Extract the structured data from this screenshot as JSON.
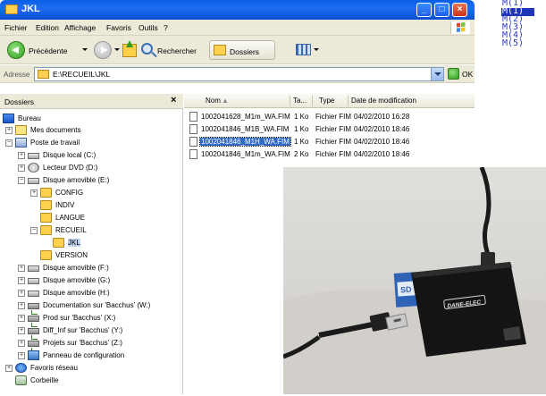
{
  "window": {
    "title": "JKL"
  },
  "menu": [
    "Fichier",
    "Edition",
    "Affichage",
    "Favoris",
    "Outils",
    "?"
  ],
  "toolbar": {
    "back_label": "Précédente",
    "search_label": "Rechercher",
    "folders_label": "Dossiers"
  },
  "address": {
    "label": "Adresse",
    "value": "E:\\RECUEIL\\JKL",
    "go_label": "OK"
  },
  "folder_pane": {
    "title": "Dossiers",
    "close": "×",
    "items": [
      {
        "label": "Bureau"
      },
      {
        "label": "Mes documents"
      },
      {
        "label": "Poste de travail"
      },
      {
        "label": "Disque local (C:)"
      },
      {
        "label": "Lecteur DVD (D:)"
      },
      {
        "label": "Disque amovible (E:)"
      },
      {
        "label": "CONFIG"
      },
      {
        "label": "INDIV"
      },
      {
        "label": "LANGUE"
      },
      {
        "label": "RECUEIL"
      },
      {
        "label": "JKL"
      },
      {
        "label": "VERSION"
      },
      {
        "label": "Disque amovible (F:)"
      },
      {
        "label": "Disque amovible (G:)"
      },
      {
        "label": "Disque amovible (H:)"
      },
      {
        "label": "Documentation sur 'Bacchus' (W:)"
      },
      {
        "label": "Prod sur 'Bacchus' (X:)"
      },
      {
        "label": "Diff_Inf sur 'Bacchus' (Y:)"
      },
      {
        "label": "Projets sur 'Bacchus' (Z:)"
      },
      {
        "label": "Panneau de configuration"
      },
      {
        "label": "Favoris réseau"
      },
      {
        "label": "Corbeille"
      }
    ]
  },
  "file_list": {
    "columns": [
      "Nom",
      "Ta...",
      "Type",
      "Date de modification"
    ],
    "rows": [
      {
        "name": "1002041628_M1m_WA.FIM",
        "size": "1 Ko",
        "type": "Fichier FIM",
        "date": "04/02/2010 16:28"
      },
      {
        "name": "1002041846_M1B_WA.FIM",
        "size": "1 Ko",
        "type": "Fichier FIM",
        "date": "04/02/2010 18:46"
      },
      {
        "name": "1002041846_M1H_WA.FIM",
        "size": "1 Ko",
        "type": "Fichier FIM",
        "date": "04/02/2010 18:46"
      },
      {
        "name": "1002041846_M1m_WA.FIM",
        "size": "2 Ko",
        "type": "Fichier FIM",
        "date": "04/02/2010 18:46"
      }
    ]
  },
  "photo": {
    "brand": "DANE-ELEC",
    "card_label": "SD"
  },
  "m_list": [
    "M(1)",
    "M(1)",
    "M(2)",
    "M(3)",
    "M(4)",
    "M(5)"
  ]
}
